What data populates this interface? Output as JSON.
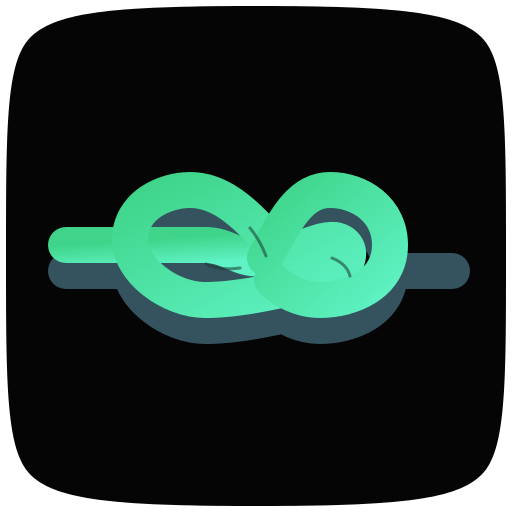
{
  "icon": {
    "name": "knot-app-icon",
    "shape": "rounded-square",
    "colors": {
      "background": "#050505",
      "rope_light": "#5ff2c4",
      "rope_dark": "#3fd489",
      "shadow": "#34535f"
    }
  }
}
